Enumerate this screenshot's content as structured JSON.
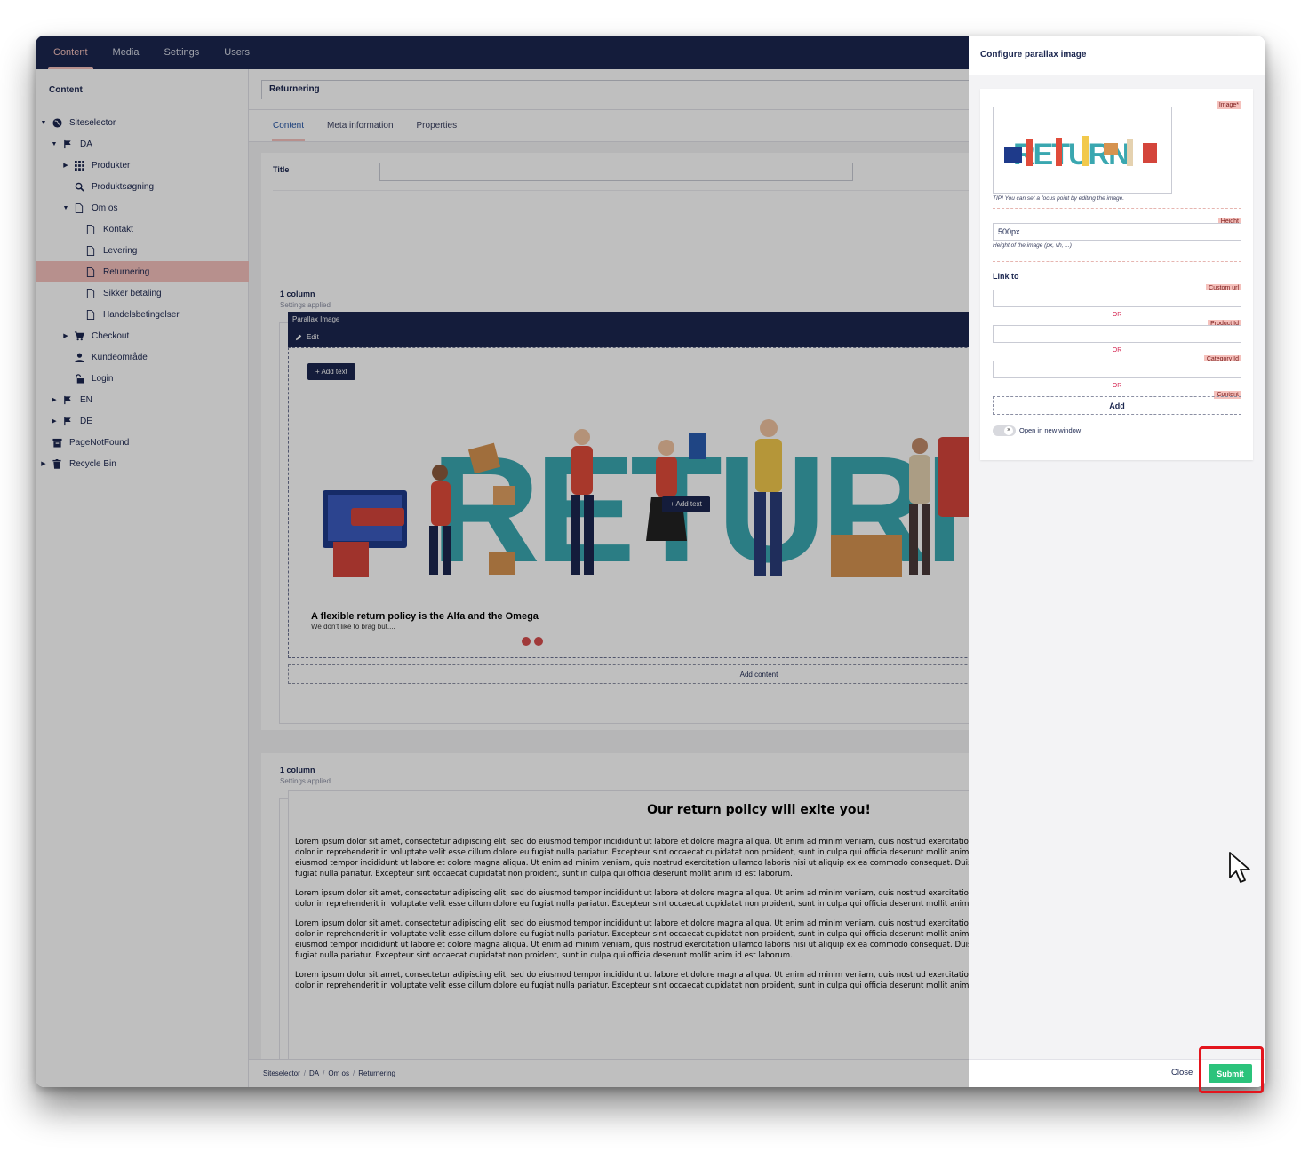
{
  "topnav": {
    "tabs": [
      "Content",
      "Media",
      "Settings",
      "Users"
    ]
  },
  "tree": {
    "heading": "Content",
    "items": [
      {
        "label": "Siteselector",
        "icon": "globe-icon"
      },
      {
        "label": "DA",
        "icon": "flag-icon"
      },
      {
        "label": "Produkter",
        "icon": "grid-icon"
      },
      {
        "label": "Produktsøgning",
        "icon": "search-icon"
      },
      {
        "label": "Om os",
        "icon": "document-icon"
      },
      {
        "label": "Kontakt",
        "icon": "document-icon"
      },
      {
        "label": "Levering",
        "icon": "document-icon"
      },
      {
        "label": "Returnering",
        "icon": "document-icon"
      },
      {
        "label": "Sikker betaling",
        "icon": "document-icon"
      },
      {
        "label": "Handelsbetingelser",
        "icon": "document-icon"
      },
      {
        "label": "Checkout",
        "icon": "cart-icon"
      },
      {
        "label": "Kundeområde",
        "icon": "user-icon"
      },
      {
        "label": "Login",
        "icon": "unlock-icon"
      },
      {
        "label": "EN",
        "icon": "flag-icon"
      },
      {
        "label": "DE",
        "icon": "flag-icon"
      },
      {
        "label": "PageNotFound",
        "icon": "archive-icon"
      },
      {
        "label": "Recycle Bin",
        "icon": "trash-icon"
      }
    ]
  },
  "editor": {
    "node_name": "Returnering",
    "tabs": [
      "Content",
      "Meta information",
      "Properties"
    ],
    "title_label": "Title",
    "grid1": {
      "title": "1 column",
      "subtitle": "Settings applied"
    },
    "parallax": {
      "title": "Parallax Image",
      "edit": "Edit",
      "add_text": "+ Add text",
      "add_text_center": "+ Add text",
      "heading": "A flexible return policy is the Alfa and the Omega",
      "subheading": "We don't like to brag but....",
      "hero_word": "RETURN"
    },
    "add_content": "Add content",
    "grid2": {
      "title": "1 column",
      "subtitle": "Settings applied"
    },
    "rte": {
      "heading": "Our return policy will exite you!",
      "paragraphs": [
        "Lorem ipsum dolor sit amet, consectetur adipiscing elit, sed do eiusmod tempor incididunt ut labore et dolore magna aliqua. Ut enim ad minim veniam, quis nostrud exercitation ullamco laboris nisi ut aliquip ex ea commodo consequat. Duis aute irure dolor in reprehenderit in voluptate velit esse cillum dolore eu fugiat nulla pariatur. Excepteur sint occaecat cupidatat non proident, sunt in culpa qui officia deserunt mollit anim id est laborum. Lorem ipsum dolor sit amet, consectetur adipiscing elit, sed do eiusmod tempor incididunt ut labore et dolore magna aliqua. Ut enim ad minim veniam, quis nostrud exercitation ullamco laboris nisi ut aliquip ex ea commodo consequat. Duis aute irure dolor in reprehenderit in voluptate velit esse cillum dolore eu fugiat nulla pariatur. Excepteur sint occaecat cupidatat non proident, sunt in culpa qui officia deserunt mollit anim id est laborum.",
        "Lorem ipsum dolor sit amet, consectetur adipiscing elit, sed do eiusmod tempor incididunt ut labore et dolore magna aliqua. Ut enim ad minim veniam, quis nostrud exercitation ullamco laboris nisi ut aliquip ex ea commodo consequat. Duis aute irure dolor in reprehenderit in voluptate velit esse cillum dolore eu fugiat nulla pariatur. Excepteur sint occaecat cupidatat non proident, sunt in culpa qui officia deserunt mollit anim id est laborum.",
        "Lorem ipsum dolor sit amet, consectetur adipiscing elit, sed do eiusmod tempor incididunt ut labore et dolore magna aliqua. Ut enim ad minim veniam, quis nostrud exercitation ullamco laboris nisi ut aliquip ex ea commodo consequat. Duis aute irure dolor in reprehenderit in voluptate velit esse cillum dolore eu fugiat nulla pariatur. Excepteur sint occaecat cupidatat non proident, sunt in culpa qui officia deserunt mollit anim id est laborum.Lorem ipsum dolor sit amet, consectetur adipiscing elit, sed do eiusmod tempor incididunt ut labore et dolore magna aliqua. Ut enim ad minim veniam, quis nostrud exercitation ullamco laboris nisi ut aliquip ex ea commodo consequat. Duis aute irure dolor in reprehenderit in voluptate velit esse cillum dolore eu fugiat nulla pariatur. Excepteur sint occaecat cupidatat non proident, sunt in culpa qui officia deserunt mollit anim id est laborum.",
        "Lorem ipsum dolor sit amet, consectetur adipiscing elit, sed do eiusmod tempor incididunt ut labore et dolore magna aliqua. Ut enim ad minim veniam, quis nostrud exercitation ullamco laboris nisi ut aliquip ex ea commodo consequat. Duis aute irure dolor in reprehenderit in voluptate velit esse cillum dolore eu fugiat nulla pariatur. Excepteur sint occaecat cupidatat non proident, sunt in culpa qui officia deserunt mollit anim id e"
      ]
    }
  },
  "breadcrumb": {
    "items": [
      "Siteselector",
      "DA",
      "Om os"
    ],
    "current": "Returnering"
  },
  "panel": {
    "title": "Configure parallax image",
    "image_tag": "Image*",
    "image_word": "RETURN",
    "tip": "TIP! You can set a focus point by editing the image.",
    "height_tag": "Height",
    "height_value": "500px",
    "height_help": "Height of the image (px, vh, ...)",
    "link_label": "Link to",
    "custom_url_tag": "Custom url",
    "product_id_tag": "Product Id",
    "category_id_tag": "Category Id",
    "content_tag": "Content",
    "or": "OR",
    "add": "Add",
    "toggle_glyph": "×",
    "open_new_window": "Open in new window",
    "close": "Close",
    "submit": "Submit"
  },
  "colors": {
    "navy": "#1b264f",
    "pink": "#f5c1bc",
    "submit_green": "#2bc37b",
    "highlight_red": "#e3151d"
  }
}
